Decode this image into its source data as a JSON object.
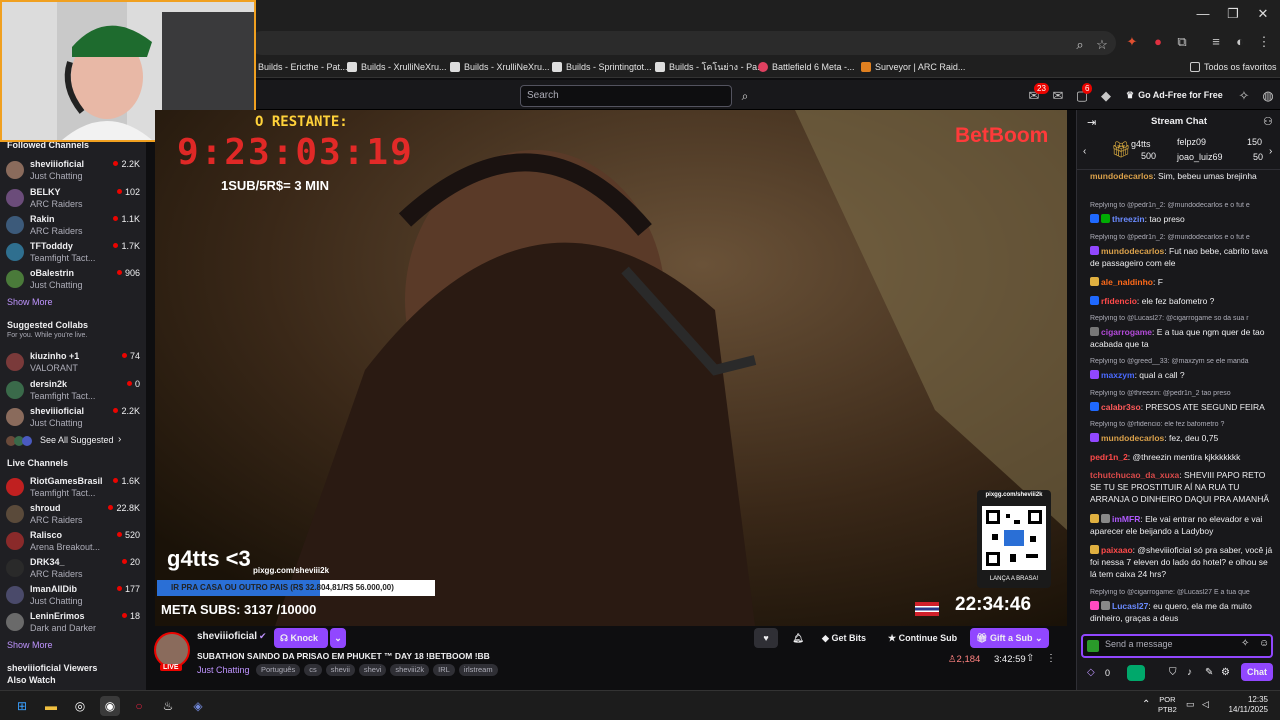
{
  "browser": {
    "tab_close": "✕",
    "tab_max": "❐",
    "tab_min": "—",
    "bookmarks": [
      {
        "label": "Builds - Ericthe - Pat..."
      },
      {
        "label": "Builds - XrulliNeXru..."
      },
      {
        "label": "Builds - XrulliNeXru..."
      },
      {
        "label": "Builds - Sprintingtot..."
      },
      {
        "label": "Builds - โคโนย่าง - Pa..."
      },
      {
        "label": "Battlefield 6 Meta -..."
      },
      {
        "label": "Surveyor | ARC Raid..."
      }
    ],
    "favorites_label": "Todos os favoritos"
  },
  "twitch_top": {
    "search_placeholder": "Search",
    "notif_count_1": "23",
    "notif_count_2": "6",
    "adfree_label": "Go Ad-Free for Free"
  },
  "sidebar": {
    "followed_title": "Followed Channels",
    "followed": [
      {
        "name": "sheviiioficial",
        "game": "Just Chatting",
        "viewers": "2.2K",
        "color": "#8a6b5c"
      },
      {
        "name": "BELKY",
        "game": "ARC Raiders",
        "viewers": "102",
        "color": "#6b4c7a"
      },
      {
        "name": "Rakin",
        "game": "ARC Raiders",
        "viewers": "1.1K",
        "color": "#3c5a7a"
      },
      {
        "name": "TFTodddy",
        "game": "Teamfight Tact...",
        "viewers": "1.7K",
        "color": "#2f6f8f"
      },
      {
        "name": "oBalestrin",
        "game": "Just Chatting",
        "viewers": "906",
        "color": "#4a7a3a"
      }
    ],
    "show_more_1": "Show More",
    "suggested_title": "Suggested Collabs",
    "suggested_sub": "For you. While you're live.",
    "suggested": [
      {
        "name": "kiuzinho +1",
        "game": "VALORANT",
        "viewers": "74",
        "color": "#7a3a3a"
      },
      {
        "name": "dersin2k",
        "game": "Teamfight Tact...",
        "viewers": "0",
        "color": "#3a6a4a"
      },
      {
        "name": "sheviiioficial",
        "game": "Just Chatting",
        "viewers": "2.2K",
        "color": "#8a6b5c"
      }
    ],
    "see_all": "See All Suggested",
    "live_title": "Live Channels",
    "live": [
      {
        "name": "RiotGamesBrasil",
        "game": "Teamfight Tact...",
        "viewers": "1.6K",
        "color": "#c02020"
      },
      {
        "name": "shroud",
        "game": "ARC Raiders",
        "viewers": "22.8K",
        "color": "#5a4a3a"
      },
      {
        "name": "Ralisco",
        "game": "Arena Breakout...",
        "viewers": "520",
        "color": "#8a2a2a"
      },
      {
        "name": "DRK34_",
        "game": "ARC Raiders",
        "viewers": "20",
        "color": "#2a2a2a"
      },
      {
        "name": "ImanAllDib",
        "game": "Just Chatting",
        "viewers": "177",
        "color": "#4a4a6a"
      },
      {
        "name": "LeninErimos",
        "game": "Dark and Darker",
        "viewers": "18",
        "color": "#6a6a6a"
      }
    ],
    "show_more_2": "Show More",
    "viewers_also_watch": "sheviiioficial Viewers Also Watch"
  },
  "player": {
    "restante": "O RESTANTE:",
    "timer": "9:23:03:19",
    "sub_rate": "1SUB/5R$= 3 MIN",
    "sponsor": "BetBoom",
    "gift_text": "g4tts <3",
    "pix_url": "pixgg.com/sheviii2k",
    "bar_text": "IR PRA CASA OU OUTRO PAIS (R$ 32.804,81/R$ 56.000,00)",
    "bar_fraction": 0.586,
    "meta_subs": "META SUBS: 3137 /10000",
    "qr_url": "pixgg.com/sheviii2k",
    "qr_caption": "LANÇA A BRASA!",
    "clock": "22:34:46"
  },
  "stream_info": {
    "channel": "sheviiioficial",
    "knock": "Knock",
    "title": "SUBATHON SAINDO DA PRISAO EM PHUKET ™ DAY 18 !BETBOOM !BB",
    "category": "Just Chatting",
    "tags": [
      "Português",
      "cs",
      "shevii",
      "shevi",
      "sheviii2k",
      "IRL",
      "irlstream"
    ],
    "get_bits": "Get Bits",
    "continue_sub": "Continue Sub",
    "gift_sub": "Gift a Sub",
    "viewers": "2,184",
    "uptime": "3:42:59",
    "live_badge": "LIVE"
  },
  "chat": {
    "title": "Stream Chat",
    "leaderboard": [
      {
        "name": "g4tts",
        "value": "500"
      },
      {
        "name": "felpz09",
        "value": "150"
      },
      {
        "name": "joao_luiz69",
        "value": "50"
      }
    ],
    "messages": [
      {
        "reply": "",
        "user": "mundodecarlos",
        "color": "#d9a04a",
        "text": "Sim, bebeu umas brejinha"
      },
      {
        "reply": "Replying to @pedr1n_2: @mundodecarlos e o fut e",
        "user": "threezin",
        "color": "#6a8aff",
        "text": "tao preso"
      },
      {
        "reply": "Replying to @pedr1n_2: @mundodecarlos e o fut e",
        "user": "mundodecarlos",
        "color": "#d9a04a",
        "text": "Fut nao bebe, cabrito tava de passageiro com ele"
      },
      {
        "reply": "",
        "user": "ale_naldinho",
        "color": "#ff6a1a",
        "text": "F"
      },
      {
        "reply": "",
        "user": "rfidencio",
        "color": "#ff4a4a",
        "text": "ele fez bafometro ?"
      },
      {
        "reply": "Replying to @Lucasl27: @cigarrogame so da sua r",
        "user": "cigarrogame",
        "color": "#b34ad9",
        "text": "E a tua que ngm quer de tao acabada que ta"
      },
      {
        "reply": "Replying to @greed__33: @maxzym se ele manda",
        "user": "maxzym",
        "color": "#4a6aff",
        "text": "qual a call ?"
      },
      {
        "reply": "Replying to @threezin: @pedr1n_2 tao preso",
        "user": "calabr3so",
        "color": "#ff5a5a",
        "text": "PRESOS ATE SEGUND FEIRA"
      },
      {
        "reply": "Replying to @rfidencio: ele fez bafometro ?",
        "user": "mundodecarlos",
        "color": "#d9a04a",
        "text": "fez, deu 0,75"
      },
      {
        "reply": "",
        "user": "pedr1n_2",
        "color": "#ff4a4a",
        "text": "@threezin mentira kjkkkkkkk"
      },
      {
        "reply": "",
        "user": "tchutchucao_da_xuxa",
        "color": "#d94a4a",
        "text": "SHEVIII PAPO RETO SE TU SE PROSTITUIR AÍ NA RUA TU ARRANJA O DINHEIRO DAQUI PRA AMANHÃ"
      },
      {
        "reply": "",
        "user": "imMFR",
        "color": "#b05aff",
        "text": "Ele vai entrar no elevador e vai aparecer ele beijando a Ladyboy"
      },
      {
        "reply": "",
        "user": "paixaao",
        "color": "#ff4a4a",
        "text": "@sheviiioficial só pra saber, você já foi nessa 7 eleven do lado do hotel? e olhou se lá tem caixa 24 hrs?"
      },
      {
        "reply": "Replying to @cigarrogame: @Lucasl27 E a tua que",
        "user": "Lucasl27",
        "color": "#6a8aff",
        "text": "eu quero, ela me da muito dinheiro, graças a deus"
      }
    ],
    "input_placeholder": "Send a message",
    "points": "0",
    "chat_button": "Chat"
  },
  "taskbar": {
    "lang": "POR",
    "layout": "PTB2",
    "time": "12:35",
    "date": "14/11/2025"
  }
}
